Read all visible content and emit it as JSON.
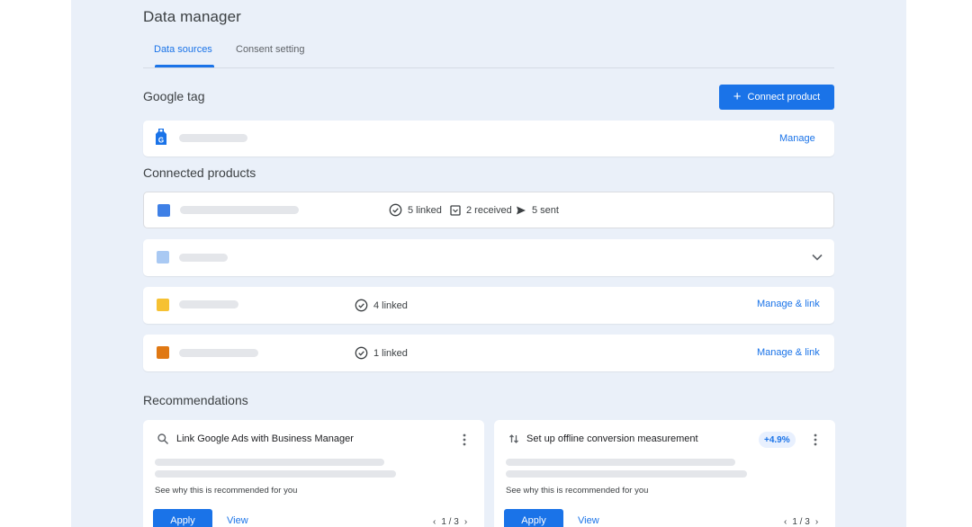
{
  "page": {
    "title": "Data manager"
  },
  "tabs": [
    {
      "label": "Data sources",
      "active": true
    },
    {
      "label": "Consent setting",
      "active": false
    }
  ],
  "google_tag": {
    "heading": "Google tag",
    "connect_button": "Connect product",
    "manage_link": "Manage",
    "icon_letter": "G"
  },
  "connected": {
    "heading": "Connected products",
    "rows": [
      {
        "color": "#3f80e6",
        "stats": [
          "5 linked",
          "2 received",
          "5 sent"
        ],
        "action": ""
      },
      {
        "color": "#a9c9f3",
        "stats": [],
        "action": "",
        "expand": "chevron-down"
      },
      {
        "color": "#f6c133",
        "stats": [
          "4 linked"
        ],
        "action": "Manage & link"
      },
      {
        "color": "#e07813",
        "stats": [
          "1 linked"
        ],
        "action": "Manage & link"
      }
    ]
  },
  "recommendations": {
    "heading": "Recommendations",
    "cards": [
      {
        "title": "Link Google Ads with Business Manager",
        "icon": "search-icon",
        "badge": "",
        "note": "See why this is recommended for you",
        "apply": "Apply",
        "view": "View",
        "pager": "1 / 3"
      },
      {
        "title": "Set up offline conversion measurement",
        "icon": "sort-arrows-icon",
        "badge": "+4.9%",
        "note": "See why this is recommended for you",
        "apply": "Apply",
        "view": "View",
        "pager": "1 / 3"
      }
    ]
  },
  "colors": {
    "accent": "#1a73e8",
    "background": "#eaf0f9"
  }
}
